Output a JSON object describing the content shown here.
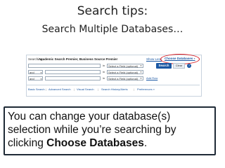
{
  "slide": {
    "title": "Search tips:",
    "subtitle": "Search Multiple Databases…"
  },
  "search_panel": {
    "searching_label": "Searching:",
    "databases": "Academic Search Premier, Business Source Premier",
    "show_less": "Show Less",
    "choose_databases": "Choose Databases",
    "choose_arrow": "»",
    "rows": [
      {
        "operator": "",
        "in_label": "in",
        "field": "Select a Field (optional)"
      },
      {
        "operator": "and",
        "in_label": "in",
        "field": "Select a Field (optional)"
      },
      {
        "operator": "and",
        "in_label": "in",
        "field": "Select a Field (optional)"
      }
    ],
    "search_button": "Search",
    "clear_button": "Clear",
    "help_icon": "?",
    "add_row": "Add Row",
    "tabs": [
      "Basic Search",
      "Advanced Search",
      "Visual Search",
      "Search History/Alerts",
      "Preferences »"
    ],
    "tab_separator": "|",
    "accent_color": "#1a57a3",
    "highlight_color": "#d9141a"
  },
  "caption": {
    "text_before": "You can change your database(s) selection while you’re searching by clicking ",
    "emphasis": "Choose Databases",
    "text_after": "."
  }
}
